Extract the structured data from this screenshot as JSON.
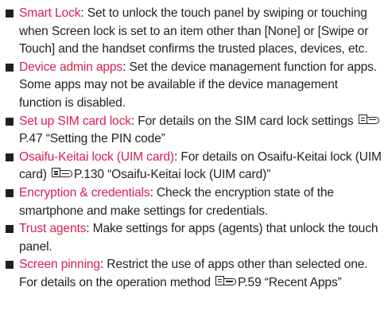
{
  "colors": {
    "term": "#d6204f",
    "text": "#231f20"
  },
  "items": [
    {
      "term": "Smart Lock",
      "body": ": Set to unlock the touch panel by swiping or touching when Screen lock is set to an item other than [None] or [Swipe or Touch] and the handset confirms the trusted places, devices, etc."
    },
    {
      "term": "Device admin apps",
      "body": ": Set the device management function for apps. Some apps may not be available if the device management function is disabled."
    },
    {
      "term": "Set up SIM card lock",
      "body": ": For details on the SIM card lock settings ",
      "ref": "P.47 “Setting the PIN code”"
    },
    {
      "term": "Osaifu-Keitai lock (UIM card)",
      "body": ": For details on Osaifu-Keitai lock (UIM card) ",
      "ref": "P.130 “Osaifu-Keitai lock (UIM card)”"
    },
    {
      "term": "Encryption & credentials",
      "body": ": Check the encryption state of the smartphone and make settings for credentials."
    },
    {
      "term": "Trust agents",
      "body": ": Make settings for apps (agents) that unlock the touch panel."
    },
    {
      "term": "Screen pinning",
      "body": ": Restrict the use of apps other than selected one. For details on the operation method ",
      "ref": "P.59 “Recent Apps”"
    }
  ]
}
